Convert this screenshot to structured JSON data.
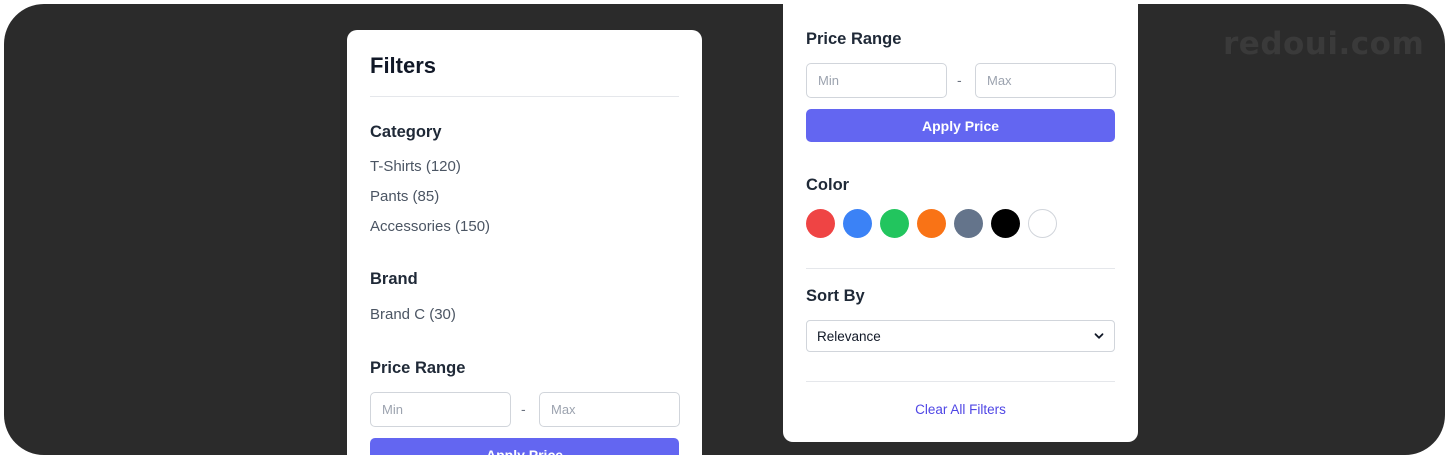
{
  "watermark": "redoui.com",
  "left_panel": {
    "title": "Filters",
    "category": {
      "heading": "Category",
      "items": [
        "T-Shirts (120)",
        "Pants (85)",
        "Accessories (150)"
      ]
    },
    "brand": {
      "heading": "Brand",
      "items": [
        "Brand C (30)"
      ]
    },
    "price": {
      "heading": "Price Range",
      "min_placeholder": "Min",
      "separator": "-",
      "max_placeholder": "Max",
      "apply_label": "Apply Price"
    }
  },
  "right_panel": {
    "price": {
      "heading": "Price Range",
      "min_placeholder": "Min",
      "separator": "-",
      "max_placeholder": "Max",
      "apply_label": "Apply Price"
    },
    "color": {
      "heading": "Color",
      "swatches": [
        {
          "name": "red",
          "hex": "#ef4444"
        },
        {
          "name": "blue",
          "hex": "#3b82f6"
        },
        {
          "name": "green",
          "hex": "#22c55e"
        },
        {
          "name": "orange",
          "hex": "#f97316"
        },
        {
          "name": "slate",
          "hex": "#64748b"
        },
        {
          "name": "black",
          "hex": "#000000"
        },
        {
          "name": "white",
          "hex": "#ffffff"
        }
      ]
    },
    "sort": {
      "heading": "Sort By",
      "selected": "Relevance"
    },
    "clear_label": "Clear All Filters"
  },
  "colors": {
    "backdrop": "#2b2b2b",
    "accent": "#6366f1",
    "link": "#4f46e5"
  }
}
